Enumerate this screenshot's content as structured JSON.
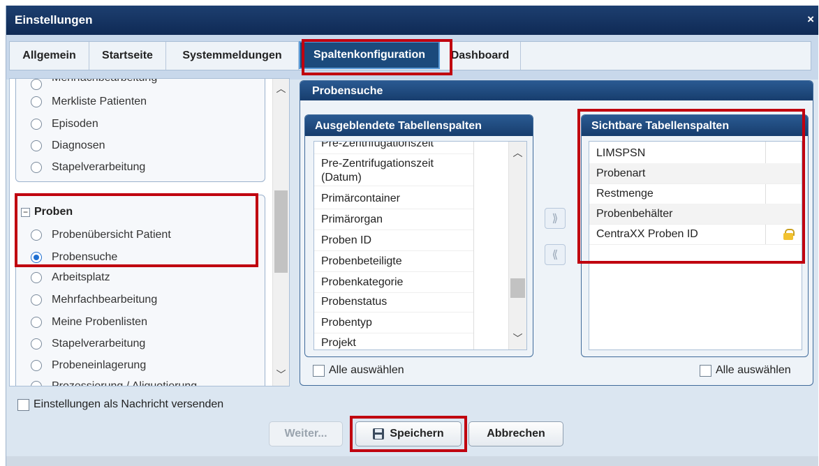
{
  "window": {
    "title": "Einstellungen",
    "close_glyph": "×"
  },
  "tabs": [
    {
      "label": "Allgemein"
    },
    {
      "label": "Startseite"
    },
    {
      "label": "Systemmeldungen"
    },
    {
      "label": "Spaltenkonfiguration",
      "active": true
    },
    {
      "label": "Dashboard"
    }
  ],
  "left_nav": {
    "group1_items": [
      "Mehrfachbearbeitung",
      "Merkliste Patienten",
      "Episoden",
      "Diagnosen",
      "Stapelverarbeitung"
    ],
    "group2_title": "Proben",
    "group2_items": [
      "Probenübersicht Patient",
      "Probensuche",
      "Arbeitsplatz",
      "Mehrfachbearbeitung",
      "Meine Probenlisten",
      "Stapelverarbeitung",
      "Probeneinlagerung",
      "Prozessierung / Aliquotierung"
    ],
    "selected": "Probensuche"
  },
  "panel": {
    "title": "Probensuche",
    "hidden_columns": {
      "title": "Ausgeblendete Tabellenspalten",
      "items": [
        "Pre-Zentrifugationszeit",
        "Pre-Zentrifugationszeit (Datum)",
        "Primärcontainer",
        "Primärorgan",
        "Proben ID",
        "Probenbeteiligte",
        "Probenkategorie",
        "Probenstatus",
        "Probentyp",
        "Projekt"
      ],
      "select_all": "Alle auswählen"
    },
    "visible_columns": {
      "title": "Sichtbare Tabellenspalten",
      "items": [
        "LIMSPSN",
        "Probenart",
        "Restmenge",
        "Probenbehälter",
        "CentraXX Proben ID"
      ],
      "locked_item": "CentraXX Proben ID",
      "select_all": "Alle auswählen"
    },
    "move_right_glyph": "⟫",
    "move_left_glyph": "⟪"
  },
  "footer": {
    "send_as_message": "Einstellungen als Nachricht versenden",
    "next_label": "Weiter...",
    "save_label": "Speichern",
    "cancel_label": "Abbrechen"
  },
  "colors": {
    "highlight": "#c0000f",
    "titlebar": "#0f2a55",
    "accent": "#1b4a7c"
  }
}
